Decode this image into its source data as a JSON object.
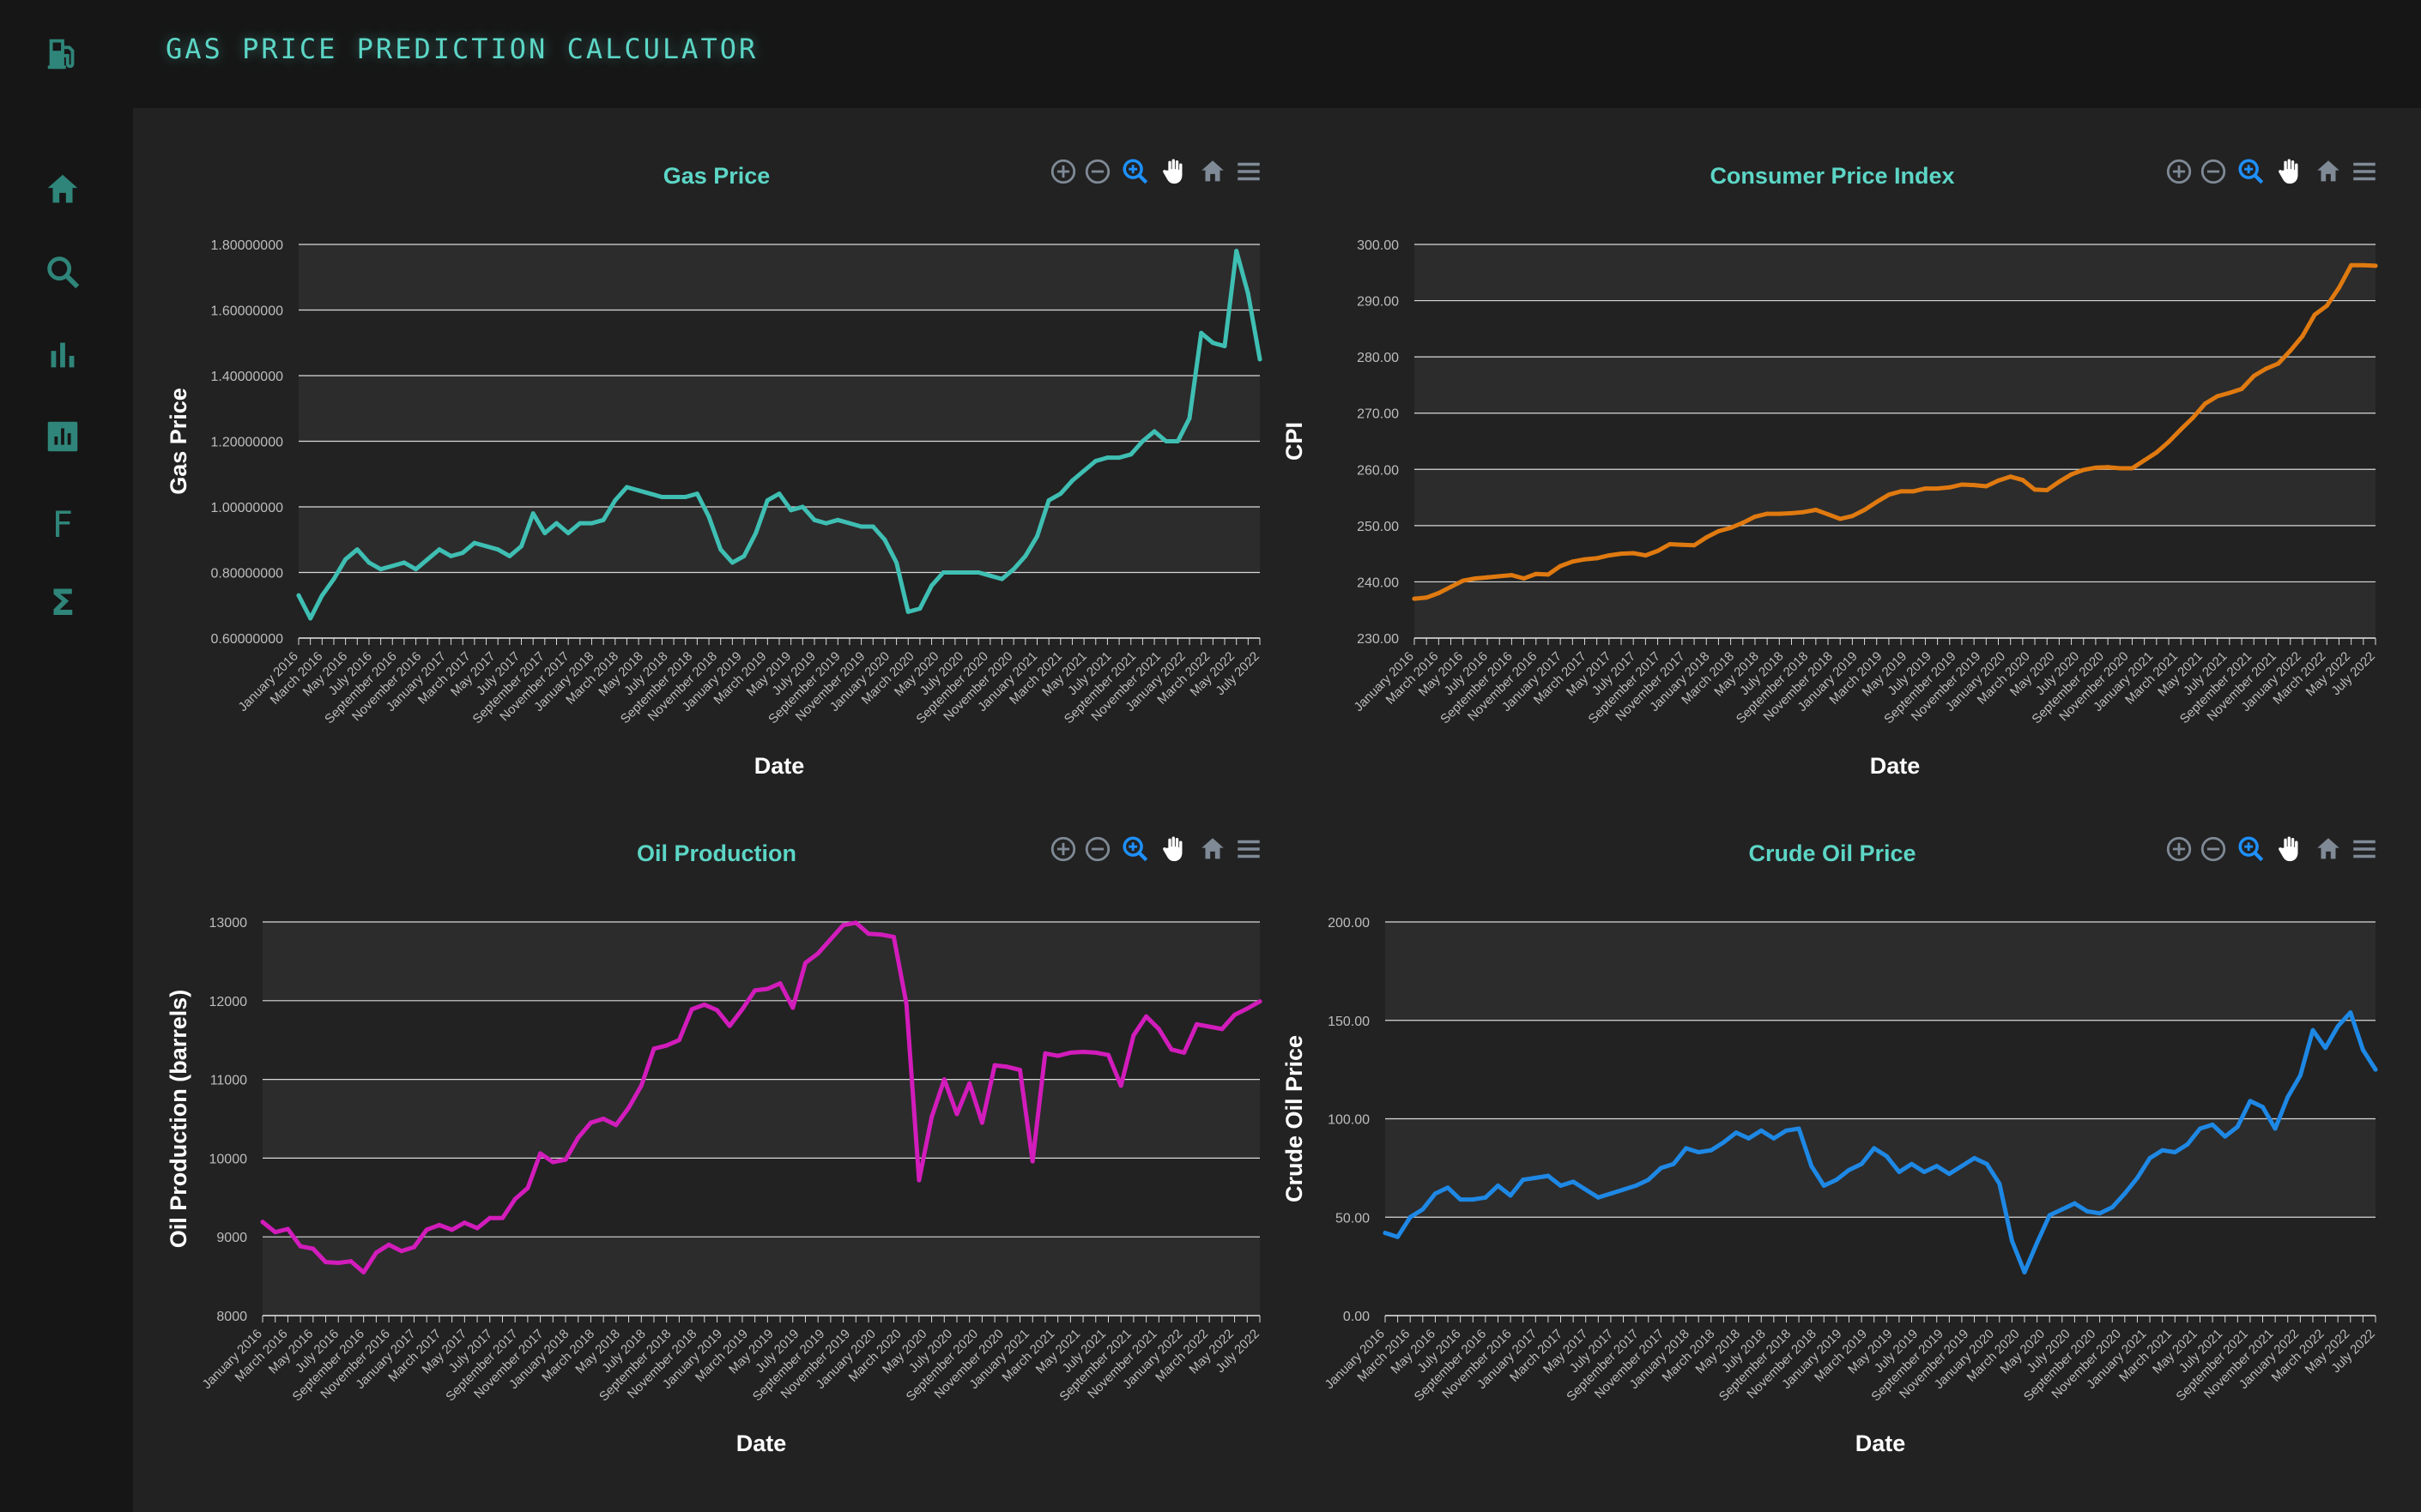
{
  "app": {
    "title": "GAS PRICE PREDICTION CALCULATOR"
  },
  "sidebar": {
    "items": [
      {
        "icon": "gas-pump-icon"
      },
      {
        "icon": "home-icon"
      },
      {
        "icon": "search-icon"
      },
      {
        "icon": "bar-chart-icon"
      },
      {
        "icon": "analytics-icon"
      },
      {
        "icon": "letter-f-icon",
        "text": "F"
      },
      {
        "icon": "sigma-icon",
        "text": "Σ"
      }
    ]
  },
  "colors": {
    "accent": "#5cd6c6",
    "icon": "#2f8579",
    "gas": "#3fbfb3",
    "cpi": "#e07a10",
    "oil_production": "#d21cbb",
    "crude_oil": "#1e88e5",
    "plot_band": "#2c2c2c",
    "toolbar_icon": "#7f8a96",
    "toolbar_active": "#1e90ff"
  },
  "toolbar": {
    "icons": [
      "zoom-in-icon",
      "zoom-out-icon",
      "selection-zoom-icon",
      "pan-icon",
      "reset-home-icon",
      "menu-icon"
    ]
  },
  "chart_data": [
    {
      "type": "line",
      "title": "Gas Price",
      "xlabel": "Date",
      "ylabel": "Gas Price",
      "ylim": [
        0.6,
        1.8
      ],
      "yticks": [
        "1.80000000",
        "1.60000000",
        "1.40000000",
        "1.20000000",
        "1.00000000",
        "0.80000000",
        "0.60000000"
      ],
      "x": [
        "January 2016",
        "March 2016",
        "May 2016",
        "July 2016",
        "September 2016",
        "November 2016",
        "January 2017",
        "March 2017",
        "May 2017",
        "July 2017",
        "September 2017",
        "November 2017",
        "January 2018",
        "March 2018",
        "May 2018",
        "July 2018",
        "September 2018",
        "November 2018",
        "January 2019",
        "March 2019",
        "May 2019",
        "July 2019",
        "September 2019",
        "November 2019",
        "January 2020",
        "March 2020",
        "May 2020",
        "July 2020",
        "September 2020",
        "November 2020",
        "January 2021",
        "March 2021",
        "May 2021",
        "July 2021",
        "September 2021",
        "November 2021",
        "January 2022",
        "March 2022",
        "May 2022",
        "July 2022"
      ],
      "series": [
        {
          "values": [
            0.73,
            0.66,
            0.73,
            0.78,
            0.84,
            0.87,
            0.83,
            0.81,
            0.82,
            0.83,
            0.81,
            0.84,
            0.87,
            0.85,
            0.86,
            0.89,
            0.88,
            0.87,
            0.85,
            0.88,
            0.98,
            0.92,
            0.95,
            0.92,
            0.95,
            0.95,
            0.96,
            1.02,
            1.06,
            1.05,
            1.04,
            1.03,
            1.03,
            1.03,
            1.04,
            0.97,
            0.87,
            0.83,
            0.85,
            0.92,
            1.02,
            1.04,
            0.99,
            1.0,
            0.96,
            0.95,
            0.96,
            0.95,
            0.94,
            0.94,
            0.9,
            0.83,
            0.68,
            0.69,
            0.76,
            0.8,
            0.8,
            0.8,
            0.8,
            0.79,
            0.78,
            0.81,
            0.85,
            0.91,
            1.02,
            1.04,
            1.08,
            1.11,
            1.14,
            1.15,
            1.15,
            1.16,
            1.2,
            1.23,
            1.2,
            1.2,
            1.27,
            1.53,
            1.5,
            1.49,
            1.78,
            1.65,
            1.45
          ]
        }
      ]
    },
    {
      "type": "line",
      "title": "Consumer Price Index",
      "xlabel": "Date",
      "ylabel": "CPI",
      "ylim": [
        230,
        300
      ],
      "yticks": [
        "300.00",
        "290.00",
        "280.00",
        "270.00",
        "260.00",
        "250.00",
        "240.00",
        "230.00"
      ],
      "x": [
        "January 2016",
        "March 2016",
        "May 2016",
        "July 2016",
        "September 2016",
        "November 2016",
        "January 2017",
        "March 2017",
        "May 2017",
        "July 2017",
        "September 2017",
        "November 2017",
        "January 2018",
        "March 2018",
        "May 2018",
        "July 2018",
        "September 2018",
        "November 2018",
        "January 2019",
        "March 2019",
        "May 2019",
        "July 2019",
        "September 2019",
        "November 2019",
        "January 2020",
        "March 2020",
        "May 2020",
        "July 2020",
        "September 2020",
        "November 2020",
        "January 2021",
        "March 2021",
        "May 2021",
        "July 2021",
        "September 2021",
        "November 2021",
        "January 2022",
        "March 2022",
        "May 2022",
        "July 2022"
      ],
      "series": [
        {
          "values": [
            237.0,
            237.2,
            238.0,
            239.1,
            240.2,
            240.6,
            240.8,
            241.0,
            241.2,
            240.6,
            241.4,
            241.3,
            242.8,
            243.6,
            244.0,
            244.2,
            244.7,
            245.0,
            245.1,
            244.7,
            245.5,
            246.7,
            246.6,
            246.5,
            247.9,
            249.0,
            249.6,
            250.5,
            251.6,
            252.1,
            252.1,
            252.2,
            252.4,
            252.8,
            252.0,
            251.2,
            251.7,
            252.8,
            254.2,
            255.5,
            256.1,
            256.1,
            256.6,
            256.6,
            256.8,
            257.3,
            257.2,
            257.0,
            258.0,
            258.7,
            258.1,
            256.4,
            256.3,
            257.8,
            259.1,
            259.9,
            260.3,
            260.4,
            260.2,
            260.2,
            261.6,
            263.0,
            264.9,
            267.1,
            269.2,
            271.7,
            273.0,
            273.6,
            274.3,
            276.6,
            277.9,
            278.8,
            281.1,
            283.7,
            287.5,
            289.1,
            292.3,
            296.3,
            296.3,
            296.2
          ]
        }
      ]
    },
    {
      "type": "line",
      "title": "Oil Production",
      "xlabel": "Date",
      "ylabel": "Oil Production (barrels)",
      "ylim": [
        8000,
        13000
      ],
      "yticks": [
        "13000",
        "12000",
        "11000",
        "10000",
        "9000",
        "8000"
      ],
      "x": [
        "January 2016",
        "March 2016",
        "May 2016",
        "July 2016",
        "September 2016",
        "November 2016",
        "January 2017",
        "March 2017",
        "May 2017",
        "July 2017",
        "September 2017",
        "November 2017",
        "January 2018",
        "March 2018",
        "May 2018",
        "July 2018",
        "September 2018",
        "November 2018",
        "January 2019",
        "March 2019",
        "May 2019",
        "July 2019",
        "September 2019",
        "November 2019",
        "January 2020",
        "March 2020",
        "May 2020",
        "July 2020",
        "September 2020",
        "November 2020",
        "January 2021",
        "March 2021",
        "May 2021",
        "July 2021",
        "September 2021",
        "November 2021",
        "January 2022",
        "March 2022",
        "May 2022",
        "July 2022"
      ],
      "series": [
        {
          "values": [
            9190,
            9060,
            9100,
            8880,
            8850,
            8680,
            8670,
            8690,
            8550,
            8800,
            8900,
            8820,
            8870,
            9090,
            9150,
            9090,
            9180,
            9110,
            9240,
            9240,
            9480,
            9620,
            10060,
            9950,
            9980,
            10260,
            10450,
            10500,
            10420,
            10640,
            10920,
            11390,
            11430,
            11500,
            11890,
            11950,
            11880,
            11680,
            11890,
            12130,
            12150,
            12220,
            11910,
            12480,
            12600,
            12780,
            12960,
            12990,
            12850,
            12840,
            12810,
            11960,
            9720,
            10520,
            11000,
            10560,
            10950,
            10450,
            11180,
            11160,
            11120,
            9960,
            11330,
            11300,
            11340,
            11350,
            11340,
            11310,
            10920,
            11560,
            11800,
            11640,
            11380,
            11340,
            11700,
            11670,
            11640,
            11820,
            11900,
            11990
          ]
        }
      ]
    },
    {
      "type": "line",
      "title": "Crude Oil Price",
      "xlabel": "Date",
      "ylabel": "Crude Oil Price",
      "ylim": [
        0,
        200
      ],
      "yticks": [
        "200.00",
        "150.00",
        "100.00",
        "50.00",
        "0.00"
      ],
      "x": [
        "January 2016",
        "March 2016",
        "May 2016",
        "July 2016",
        "September 2016",
        "November 2016",
        "January 2017",
        "March 2017",
        "May 2017",
        "July 2017",
        "September 2017",
        "November 2017",
        "January 2018",
        "March 2018",
        "May 2018",
        "July 2018",
        "September 2018",
        "November 2018",
        "January 2019",
        "March 2019",
        "May 2019",
        "July 2019",
        "September 2019",
        "November 2019",
        "January 2020",
        "March 2020",
        "May 2020",
        "July 2020",
        "September 2020",
        "November 2020",
        "January 2021",
        "March 2021",
        "May 2021",
        "July 2021",
        "September 2021",
        "November 2021",
        "January 2022",
        "March 2022",
        "May 2022",
        "July 2022"
      ],
      "series": [
        {
          "values": [
            42,
            40,
            50,
            54,
            62,
            65,
            59,
            59,
            60,
            66,
            61,
            69,
            70,
            71,
            66,
            68,
            64,
            60,
            62,
            64,
            66,
            69,
            75,
            77,
            85,
            83,
            84,
            88,
            93,
            90,
            94,
            90,
            94,
            95,
            76,
            66,
            69,
            74,
            77,
            85,
            81,
            73,
            77,
            73,
            76,
            72,
            76,
            80,
            77,
            67,
            38,
            22,
            37,
            51,
            54,
            57,
            53,
            52,
            55,
            62,
            70,
            80,
            84,
            83,
            87,
            95,
            97,
            91,
            96,
            109,
            106,
            95,
            111,
            122,
            145,
            136,
            147,
            154,
            135,
            125
          ]
        }
      ]
    }
  ]
}
